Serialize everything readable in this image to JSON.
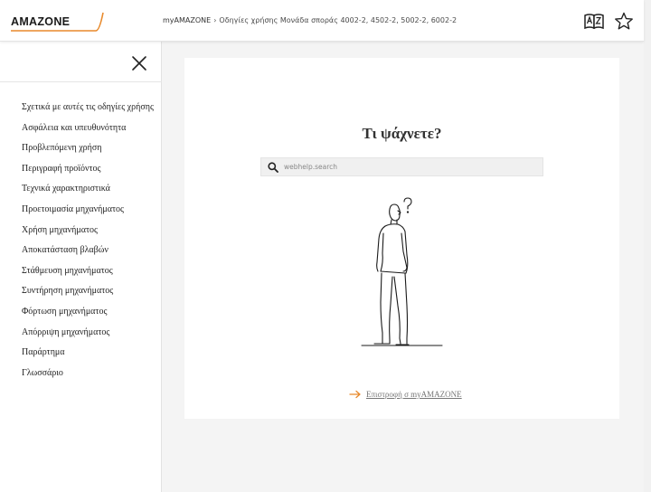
{
  "header": {
    "logo_text": "AMAZONE",
    "breadcrumb": {
      "root": "myAMAZONE",
      "separator": "›",
      "current": "Οδηγίες χρήσης Μονάδα σποράς 4002-2, 4502-2, 5002-2, 6002-2"
    },
    "icons": [
      "dictionary-icon",
      "star-icon"
    ]
  },
  "sidebar": {
    "items": [
      {
        "label": "Σχετικά με αυτές τις οδηγίες χρήσης"
      },
      {
        "label": "Ασφάλεια και υπευθυνότητα"
      },
      {
        "label": "Προβλεπόμενη χρήση"
      },
      {
        "label": "Περιγραφή προϊόντος"
      },
      {
        "label": "Τεχνικά χαρακτηριστικά"
      },
      {
        "label": "Προετοιμασία μηχανήματος"
      },
      {
        "label": "Χρήση μηχανήματος"
      },
      {
        "label": "Αποκατάσταση βλαβών"
      },
      {
        "label": "Στάθμευση μηχανήματος"
      },
      {
        "label": "Συντήρηση μηχανήματος"
      },
      {
        "label": "Φόρτωση μηχανήματος"
      },
      {
        "label": "Απόρριψη μηχανήματος"
      },
      {
        "label": "Παράρτημα"
      },
      {
        "label": "Γλωσσάριο"
      }
    ]
  },
  "main": {
    "title": "Τι ψάχνετε?",
    "search": {
      "value": "",
      "placeholder": "webhelp.search"
    },
    "back_link": "Επιστροφή σ myAMAZONE"
  },
  "colors": {
    "brand_orange": "#e8892b",
    "logo_text": "#1a1a1a",
    "page_bg": "#f4f4f4",
    "card_bg": "#ffffff"
  }
}
